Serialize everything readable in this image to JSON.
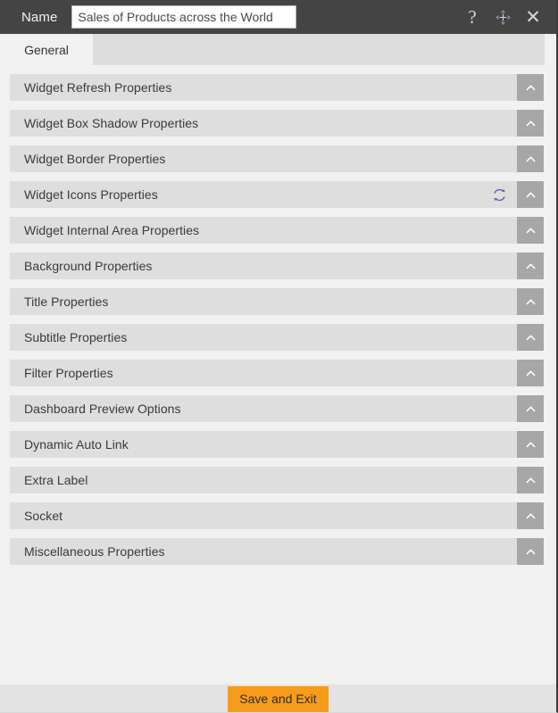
{
  "titlebar": {
    "name_label": "Name",
    "name_value": "Sales of Products across the World",
    "name_placeholder": "",
    "help_icon": "question-mark-icon",
    "move_icon": "move-four-arrows-icon",
    "close_icon": "close-x-icon",
    "background_color": "#444444"
  },
  "tabs": [
    {
      "label": "General",
      "active": true
    }
  ],
  "accordion": {
    "sections": [
      {
        "label": "Widget Refresh Properties",
        "expanded": false,
        "has_sync_icon": false
      },
      {
        "label": "Widget Box Shadow Properties",
        "expanded": false,
        "has_sync_icon": false
      },
      {
        "label": "Widget Border Properties",
        "expanded": false,
        "has_sync_icon": false
      },
      {
        "label": "Widget Icons Properties",
        "expanded": false,
        "has_sync_icon": true
      },
      {
        "label": "Widget Internal Area Properties",
        "expanded": false,
        "has_sync_icon": false
      },
      {
        "label": "Background Properties",
        "expanded": false,
        "has_sync_icon": false
      },
      {
        "label": "Title Properties",
        "expanded": false,
        "has_sync_icon": false
      },
      {
        "label": "Subtitle Properties",
        "expanded": false,
        "has_sync_icon": false
      },
      {
        "label": "Filter Properties",
        "expanded": false,
        "has_sync_icon": false
      },
      {
        "label": "Dashboard Preview Options",
        "expanded": false,
        "has_sync_icon": false
      },
      {
        "label": "Dynamic Auto Link",
        "expanded": false,
        "has_sync_icon": false
      },
      {
        "label": "Extra Label",
        "expanded": false,
        "has_sync_icon": false
      },
      {
        "label": "Socket",
        "expanded": false,
        "has_sync_icon": false
      },
      {
        "label": "Miscellaneous Properties",
        "expanded": false,
        "has_sync_icon": false
      }
    ],
    "toggle_icon": "chevron-up-icon",
    "sync_icon": "sync-refresh-icon",
    "row_color": "#dedede",
    "toggle_color": "#a7a7a7"
  },
  "footer": {
    "save_label": "Save and Exit",
    "save_color": "#f79c1a",
    "background_color": "#e3e3e3"
  }
}
